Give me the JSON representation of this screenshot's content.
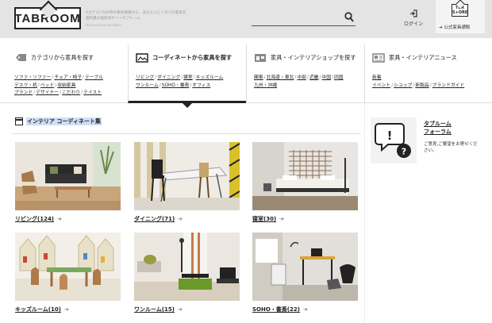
{
  "header": {
    "logo_text": "TABROOM",
    "tagline": [
      "6カテゴリ500件の家具情報から、あなたにピッタリの家具を",
      "国内最大級家具サイトタブルーム"
    ],
    "produced_by": "PRODUCED BY ⊕ECBNET",
    "search_placeholder": "",
    "login_label": "ログイン",
    "store_logo": "TBR S+ORE",
    "store_link": "公式家具通販"
  },
  "nav": [
    {
      "title": "カテゴリから家具を探す",
      "icon": "category-tag-icon",
      "links": [
        [
          "ソファ・ソファー",
          "チェア・椅子",
          "テーブル"
        ],
        [
          "デスク・机",
          "ベッド",
          "収納家具"
        ],
        [
          "ブランド",
          "デザイナー",
          "こだわり",
          "テイスト"
        ]
      ]
    },
    {
      "title": "コーディネートから家具を探す",
      "icon": "photo-icon",
      "active": true,
      "links": [
        [
          "リビング",
          "ダイニング",
          "寝室",
          "キッズルーム"
        ],
        [
          "ワンルーム",
          "SOHO・書斎",
          "オフィス"
        ]
      ]
    },
    {
      "title": "家具・インテリアショップを探す",
      "icon": "shop-icon",
      "links": [
        [
          "関東",
          "北海道・東北",
          "中部",
          "近畿",
          "中国",
          "四国"
        ],
        [
          "九州・沖縄"
        ]
      ]
    },
    {
      "title": "家具・インテリアニュース",
      "icon": "newspaper-icon",
      "links": [
        [
          "新着"
        ],
        [
          "イベント",
          "ショップ",
          "新製品",
          "ブランドガイド"
        ]
      ]
    }
  ],
  "section": {
    "title": "インテリア コーディネート集"
  },
  "cards": [
    {
      "label": "リビング(124)",
      "scene": "living"
    },
    {
      "label": "ダイニング(71)",
      "scene": "dining"
    },
    {
      "label": "寝室(30)",
      "scene": "bedroom"
    },
    {
      "label": "キッズルーム(10)",
      "scene": "kids"
    },
    {
      "label": "ワンルーム(15)",
      "scene": "oneroom"
    },
    {
      "label": "SOHO・書斎(22)",
      "scene": "soho"
    }
  ],
  "forum": {
    "title_lines": [
      "タブルーム",
      "フォーラム"
    ],
    "desc": "ご意見,ご要望をお寄せください。"
  },
  "colors": {
    "header_bg": "#e4e4e4",
    "highlight": "#cfe0f4",
    "text": "#222222"
  }
}
